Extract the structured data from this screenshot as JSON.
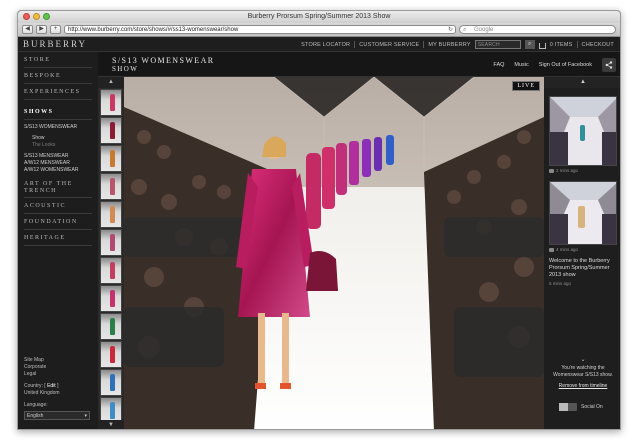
{
  "browser": {
    "window_title": "Burberry Prorsum Spring/Summer 2013 Show",
    "url": "http://www.burberry.com/store/shows/#/ss13-womenswear/show",
    "search_placeholder": "Google",
    "back": "◀",
    "forward": "▶",
    "add": "+",
    "reload": "↻"
  },
  "header": {
    "logo": "BURBERRY",
    "links": [
      "STORE LOCATOR",
      "CUSTOMER SERVICE",
      "MY BURBERRY"
    ],
    "search_placeholder": "SEARCH",
    "items": "0 ITEMS",
    "checkout": "CHECKOUT"
  },
  "sidebar": {
    "items": [
      "STORE",
      "BESPOKE",
      "EXPERIENCES",
      "SHOWS"
    ],
    "shows_sub": [
      "S/S13 WOMENSWEAR",
      "Show",
      "The Looks",
      "S/S13 MENSWEAR",
      "A/W12 MENSWEAR",
      "A/W12 WOMENSWEAR"
    ],
    "items2": [
      "ART OF THE TRENCH",
      "ACOUSTIC",
      "FOUNDATION",
      "HERITAGE"
    ],
    "footer": {
      "sitemap": "Site Map",
      "corporate": "Corporate",
      "legal": "Legal",
      "country_label": "Country:",
      "edit": "Edit",
      "country": "United Kingdom",
      "language_label": "Language:",
      "language": "English"
    }
  },
  "show": {
    "title_line1": "S/S13 WOMENSWEAR",
    "title_line2": "SHOW",
    "links": [
      "FAQ",
      "Music",
      "Sign Out of Facebook"
    ],
    "live": "LIVE"
  },
  "rightrail": {
    "post1_time": "2 mins ago",
    "post2_time": "4 mins ago",
    "post3_text": "Welcome to the Burberry Prorsum Spring/Summer 2013 show",
    "post3_time": "6 mins ago",
    "watching_text": "You're watching the Womenswear S/S13 show.",
    "remove": "Remove from timeline",
    "social": "Social On"
  },
  "thumb_colors": [
    "#c73a63",
    "#8a1c34",
    "#c77a33",
    "#b7556b",
    "#d08a52",
    "#b14a73",
    "#c04060",
    "#c2336f",
    "#2a7f4b",
    "#c92a3b",
    "#2f72b8",
    "#3f8dc7"
  ]
}
